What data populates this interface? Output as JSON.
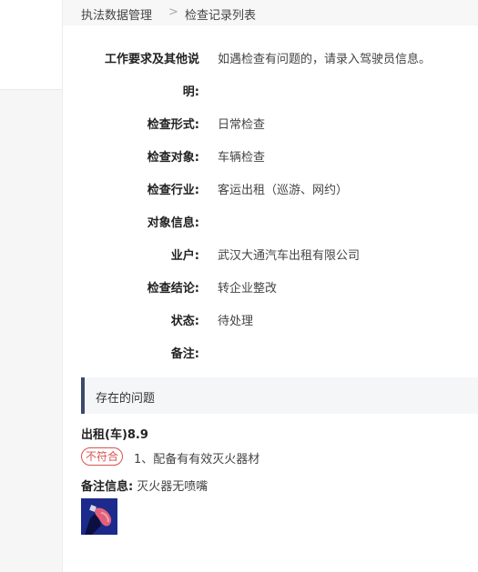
{
  "breadcrumb": {
    "parent": "执法数据管理",
    "separator": ">",
    "current": "检查记录列表"
  },
  "fields": [
    {
      "label": "工作要求及其他说",
      "value": "如遇检查有问题的，请录入驾驶员信息。"
    },
    {
      "label": "明:",
      "value": ""
    },
    {
      "label": "检查形式:",
      "value": "日常检查"
    },
    {
      "label": "检查对象:",
      "value": "车辆检查"
    },
    {
      "label": "检查行业:",
      "value": "客运出租（巡游、网约）"
    },
    {
      "label": "对象信息:",
      "value": ""
    },
    {
      "label": "业户:",
      "value": "武汉大通汽车出租有限公司"
    },
    {
      "label": "检查结论:",
      "value": "转企业整改"
    },
    {
      "label": "状态:",
      "value": "待处理"
    },
    {
      "label": "备注:",
      "value": ""
    }
  ],
  "problems_section": {
    "title": "存在的问题",
    "item_title": "出租(车)8.9",
    "badge": "不符合",
    "issue": "1、配备有有效灭火器材",
    "note_label": "备注信息:",
    "note_value": "灭火器无喷嘴"
  },
  "colors": {
    "accent_bar": "#3b4a6b",
    "badge_red": "#d9534f"
  }
}
